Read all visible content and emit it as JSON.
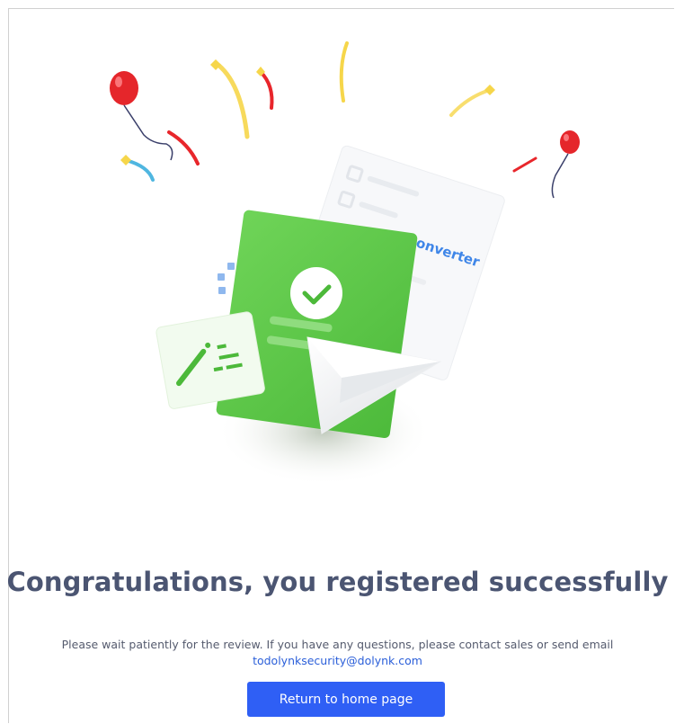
{
  "illustration": {
    "card_label": "Converter",
    "colors": {
      "green": "#5fc94a",
      "balloon_red": "#e8272b",
      "confetti_yellow": "#f2cf3c",
      "confetti_blue": "#4fb6e0",
      "label_blue": "#3f86e8"
    },
    "icons": [
      "balloon-icon",
      "confetti-icon",
      "checkmark-icon",
      "paper-plane-icon",
      "pencil-icon"
    ]
  },
  "main": {
    "title": "Congratulations, you registered successfully",
    "description": "Please wait patiently for the review. If you have any questions, please contact sales or send email",
    "email": "todolynksecurity@dolynk.com",
    "return_button_label": "Return to home page"
  },
  "theme": {
    "accent": "#2f5ff5",
    "title_color": "#4b5572",
    "text_color": "#555b6e",
    "link_color": "#2b5fd9"
  }
}
